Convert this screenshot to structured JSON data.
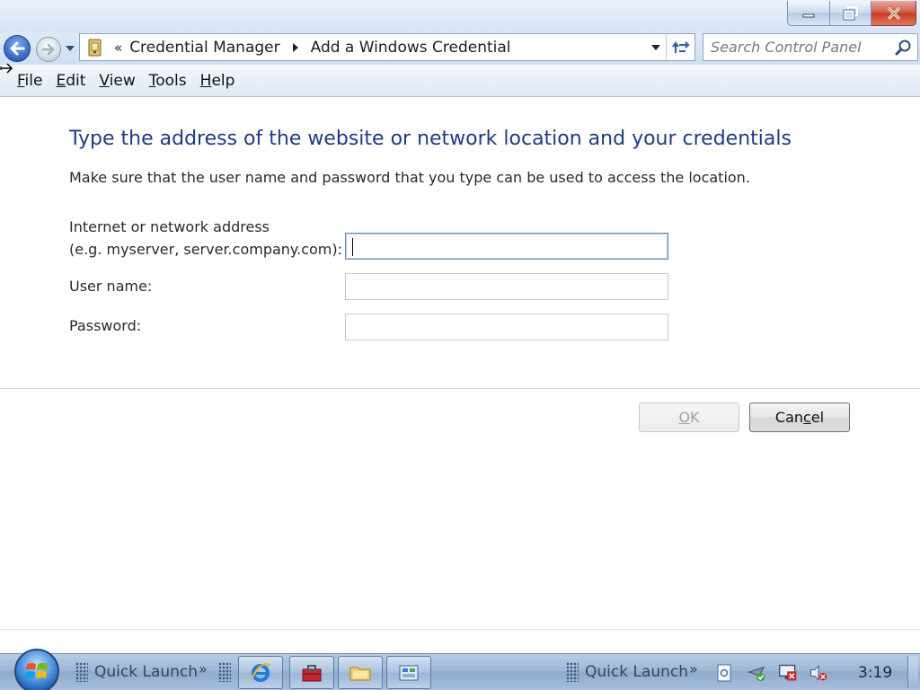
{
  "window": {
    "controls": {
      "minimize": "minimize",
      "restore": "restore",
      "close": "close"
    }
  },
  "nav": {
    "breadcrumbs": [
      "Credential Manager",
      "Add a Windows Credential"
    ],
    "overflow_glyph": "«",
    "search_placeholder": "Search Control Panel"
  },
  "menu": {
    "items": [
      "File",
      "Edit",
      "View",
      "Tools",
      "Help"
    ]
  },
  "form": {
    "heading": "Type the address of the website or network location and your credentials",
    "instruction": "Make sure that the user name and password that you type can be used to access the location.",
    "address_label_line1": "Internet or network address",
    "address_label_line2": "(e.g. myserver, server.company.com):",
    "address_value": "",
    "username_label": "User name:",
    "username_value": "",
    "password_label": "Password:",
    "password_value": "",
    "ok_label": "OK",
    "cancel_label_pre": "Can",
    "cancel_label_underlined": "c",
    "cancel_label_post": "el"
  },
  "taskbar": {
    "quick_launch_label": "Quick Launch",
    "quick_launch_chevron": "»",
    "clock": "3:19",
    "icons": [
      "internet-explorer-icon",
      "toolbox-icon",
      "explorer-folder-icon",
      "control-panel-icon"
    ],
    "tray_icons": [
      "document-icon",
      "network-icon",
      "monitor-error-icon",
      "volume-muted-icon"
    ]
  },
  "colors": {
    "heading": "#1e3a8a",
    "titlebar": "#d6e4f5",
    "taskbar": "#9db7d5",
    "close_button": "#c63a22"
  }
}
